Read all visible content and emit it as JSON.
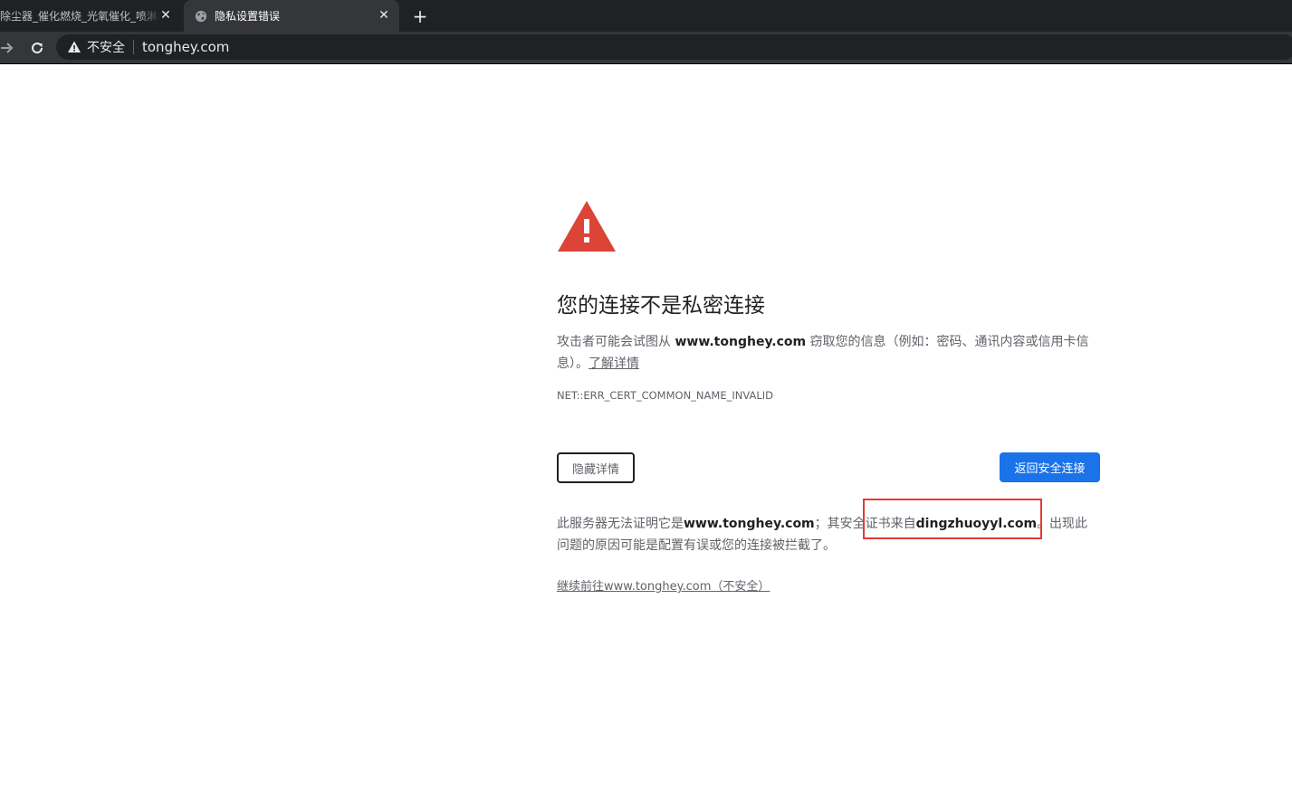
{
  "tabs": [
    {
      "title": "除尘器_催化燃烧_光氧催化_喷淋塔",
      "close": "✕",
      "active": false
    },
    {
      "title": "隐私设置错误",
      "close": "✕",
      "active": true
    }
  ],
  "new_tab_label": "+",
  "toolbar": {
    "security_label": "不安全",
    "url": "tonghey.com"
  },
  "interstitial": {
    "heading": "您的连接不是私密连接",
    "para1_prefix": "攻击者可能会试图从 ",
    "para1_host": "www.tonghey.com",
    "para1_suffix": " 窃取您的信息（例如：密码、通讯内容或信用卡信息）。",
    "learn_more": "了解详情",
    "error_code": "NET::ERR_CERT_COMMON_NAME_INVALID",
    "hide_details_button": "隐藏详情",
    "back_button": "返回安全连接",
    "para2_prefix": "此服务器无法证明它是",
    "para2_host": "www.tonghey.com",
    "para2_mid": "；其安全证书来自",
    "para2_cert_host": "dingzhuoyyl.com",
    "para2_suffix": "。出现此问题的原因可能是配置有误或您的连接被拦截了。",
    "proceed_link": "继续前往www.tonghey.com（不安全）"
  },
  "colors": {
    "tabstrip_bg": "#202124",
    "toolbar_bg": "#35363a",
    "warning_red": "#db4437",
    "primary_blue": "#1a73e8",
    "annotation_red": "#e53935"
  },
  "icons": {
    "back": "back-arrow-icon",
    "forward": "forward-arrow-icon",
    "reload": "reload-icon",
    "warning": "warning-triangle-icon",
    "globe": "globe-icon",
    "close": "close-icon",
    "plus": "plus-icon"
  }
}
